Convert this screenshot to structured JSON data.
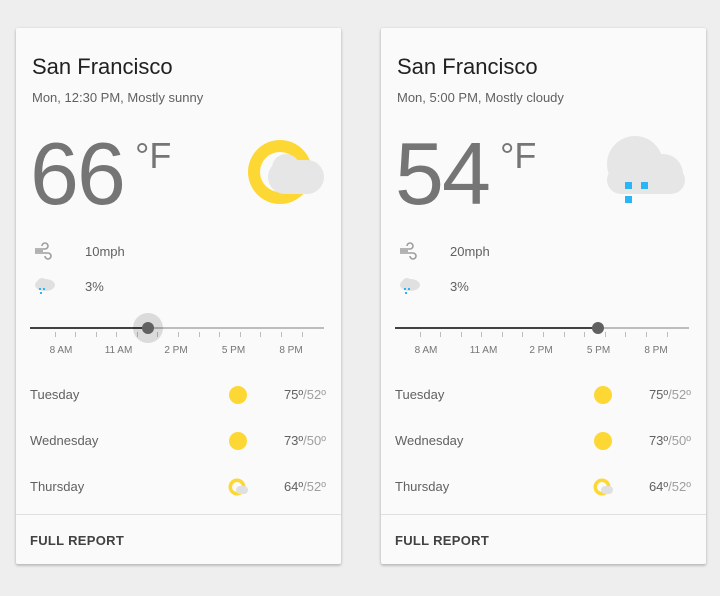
{
  "cards": [
    {
      "city": "San Francisco",
      "subtitle": "Mon, 12:30 PM, Mostly sunny",
      "temp": "66",
      "unit": "°F",
      "condition_icon": "partly-sunny-icon",
      "wind": {
        "icon": "wind-icon",
        "value": "10mph"
      },
      "precip": {
        "icon": "rain-cloud-icon",
        "value": "3%"
      },
      "time_slider": {
        "ticks": [
          "8 AM",
          "11 AM",
          "2 PM",
          "5 PM",
          "8 PM"
        ],
        "value_fraction": 0.4,
        "focused": true
      },
      "forecast": [
        {
          "day": "Tuesday",
          "icon": "sun-icon",
          "high": "75º",
          "low": "/52º"
        },
        {
          "day": "Wednesday",
          "icon": "sun-icon",
          "high": "73º",
          "low": "/50º"
        },
        {
          "day": "Thursday",
          "icon": "partly-sunny-icon",
          "high": "64º",
          "low": "/52º"
        }
      ],
      "action": "FULL REPORT"
    },
    {
      "city": "San Francisco",
      "subtitle": "Mon, 5:00 PM, Mostly cloudy",
      "temp": "54",
      "unit": "°F",
      "condition_icon": "rain-cloud-icon",
      "wind": {
        "icon": "wind-icon",
        "value": "20mph"
      },
      "precip": {
        "icon": "rain-cloud-icon",
        "value": "3%"
      },
      "time_slider": {
        "ticks": [
          "8 AM",
          "11 AM",
          "2 PM",
          "5 PM",
          "8 PM"
        ],
        "value_fraction": 0.69,
        "focused": false
      },
      "forecast": [
        {
          "day": "Tuesday",
          "icon": "sun-icon",
          "high": "75º",
          "low": "/52º"
        },
        {
          "day": "Wednesday",
          "icon": "sun-icon",
          "high": "73º",
          "low": "/50º"
        },
        {
          "day": "Thursday",
          "icon": "partly-sunny-icon",
          "high": "64º",
          "low": "/52º"
        }
      ],
      "action": "FULL REPORT"
    }
  ],
  "colors": {
    "sun": "#fdd835",
    "cloud": "#eeeeee",
    "rain": "#29b6f6",
    "thumb": "#616161"
  }
}
